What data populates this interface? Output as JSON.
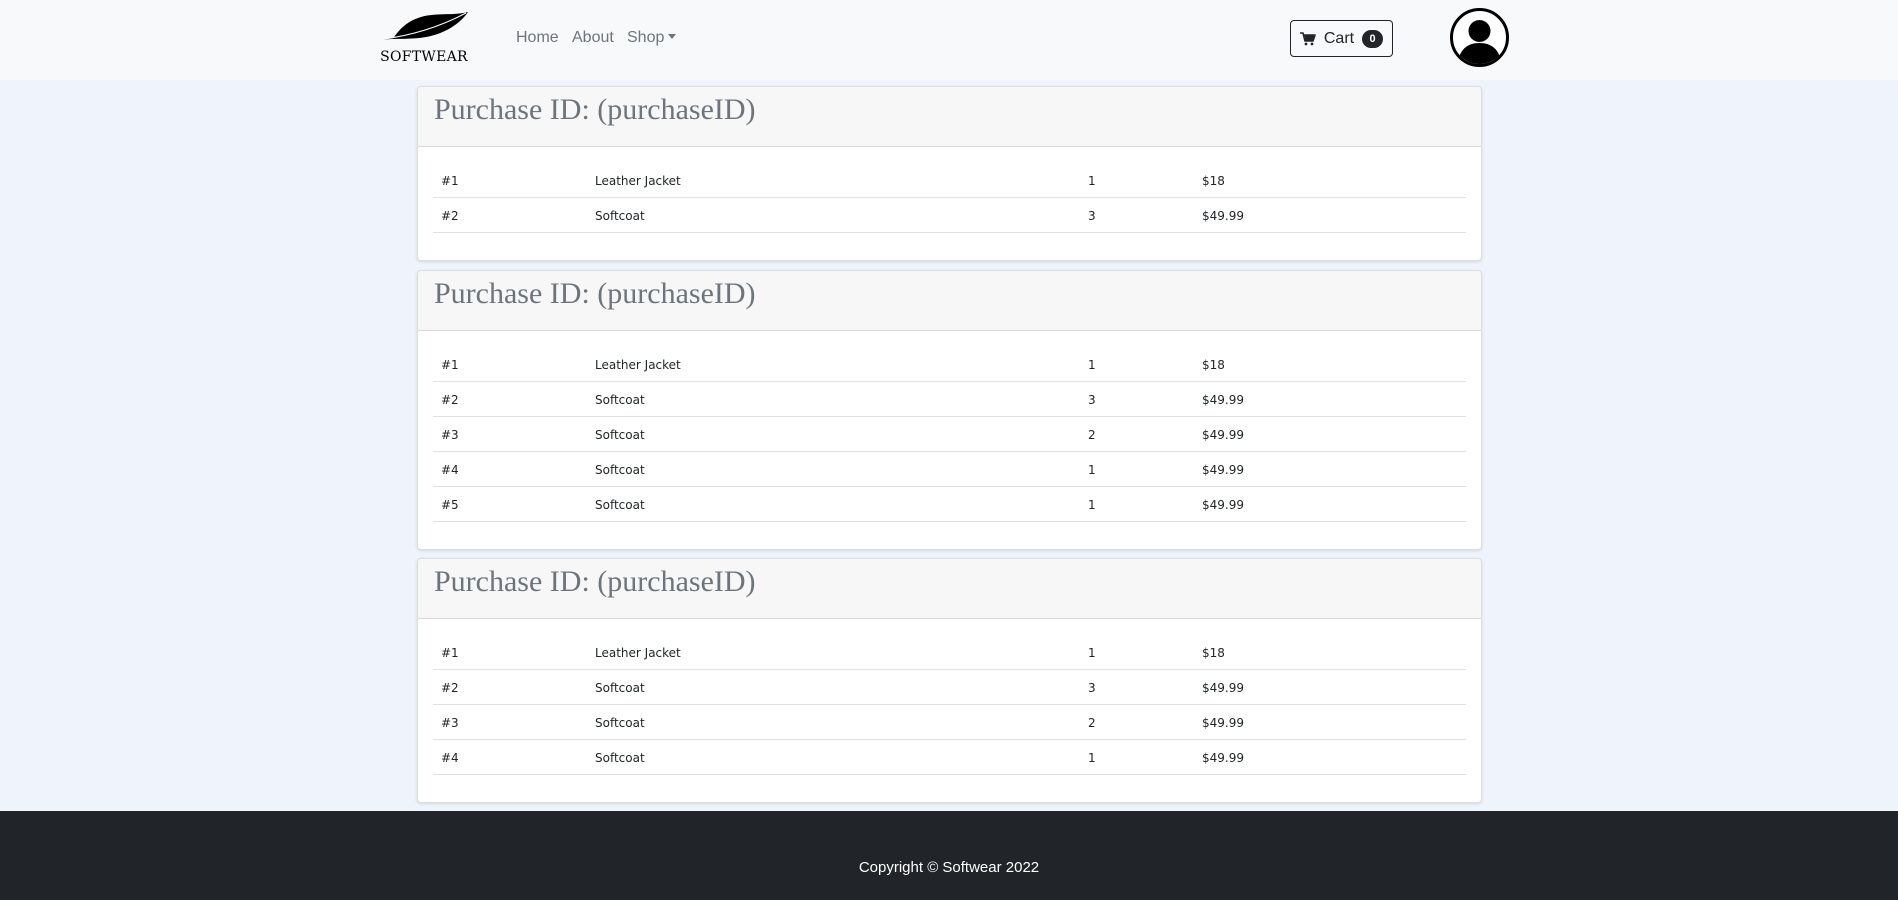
{
  "brand": {
    "name": "SOFTWEAR"
  },
  "nav": {
    "home": "Home",
    "about": "About",
    "shop": "Shop"
  },
  "cart": {
    "label": "Cart",
    "count": "0"
  },
  "purchases": [
    {
      "title": "Purchase ID: (purchaseID)",
      "items": [
        {
          "index": "#1",
          "name": "Leather Jacket",
          "qty": "1",
          "price": "$18"
        },
        {
          "index": "#2",
          "name": "Softcoat",
          "qty": "3",
          "price": "$49.99"
        }
      ]
    },
    {
      "title": "Purchase ID: (purchaseID)",
      "items": [
        {
          "index": "#1",
          "name": "Leather Jacket",
          "qty": "1",
          "price": "$18"
        },
        {
          "index": "#2",
          "name": "Softcoat",
          "qty": "3",
          "price": "$49.99"
        },
        {
          "index": "#3",
          "name": "Softcoat",
          "qty": "2",
          "price": "$49.99"
        },
        {
          "index": "#4",
          "name": "Softcoat",
          "qty": "1",
          "price": "$49.99"
        },
        {
          "index": "#5",
          "name": "Softcoat",
          "qty": "1",
          "price": "$49.99"
        }
      ]
    },
    {
      "title": "Purchase ID: (purchaseID)",
      "items": [
        {
          "index": "#1",
          "name": "Leather Jacket",
          "qty": "1",
          "price": "$18"
        },
        {
          "index": "#2",
          "name": "Softcoat",
          "qty": "3",
          "price": "$49.99"
        },
        {
          "index": "#3",
          "name": "Softcoat",
          "qty": "2",
          "price": "$49.99"
        },
        {
          "index": "#4",
          "name": "Softcoat",
          "qty": "1",
          "price": "$49.99"
        }
      ]
    }
  ],
  "footer": {
    "copyright": "Copyright © Softwear 2022"
  },
  "icons": {
    "logo": "feather-icon",
    "cart": "cart-icon",
    "avatar": "user-avatar-icon"
  },
  "colors": {
    "navbar": "#f8f9fa",
    "page": "#eff3fb",
    "footer": "#212529",
    "muted": "#6c757d"
  }
}
